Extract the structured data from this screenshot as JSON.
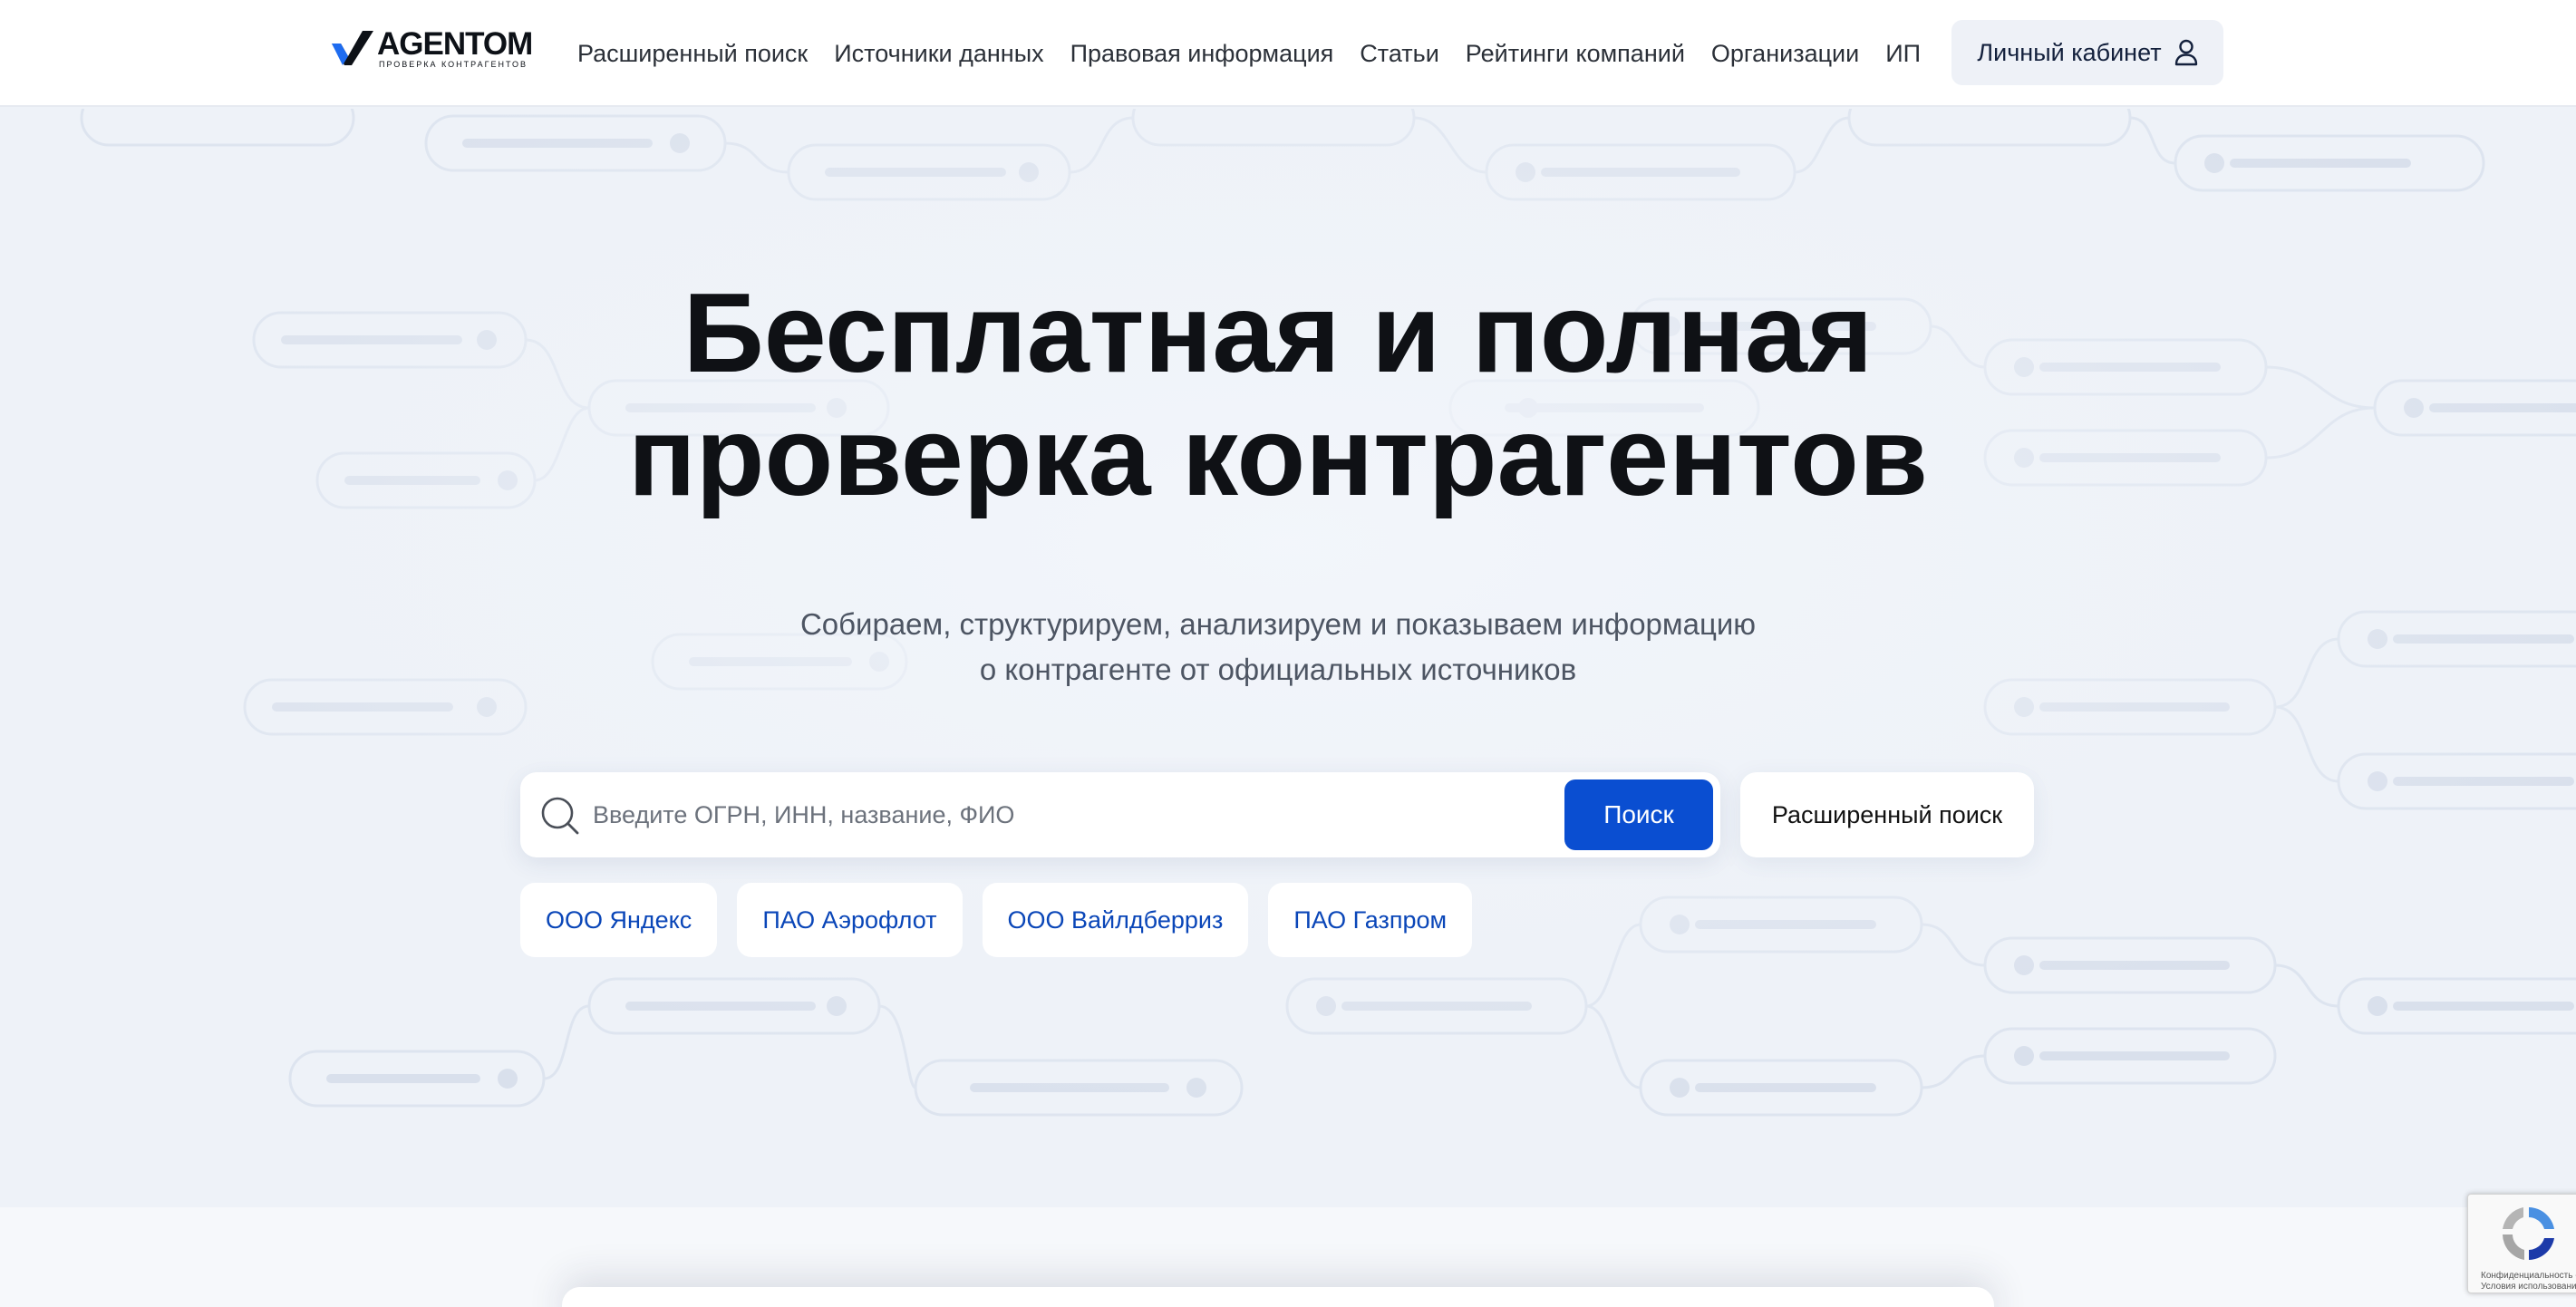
{
  "brand": {
    "name": "AGENTOM",
    "tagline": "ПРОВЕРКА КОНТРАГЕНТОВ"
  },
  "nav": {
    "items": [
      "Расширенный поиск",
      "Источники данных",
      "Правовая информация",
      "Статьи",
      "Рейтинги компаний",
      "Организации",
      "ИП"
    ]
  },
  "header": {
    "cabinet_label": "Личный кабинет",
    "cabinet_icon": "user-icon"
  },
  "hero": {
    "title_line1": "Бесплатная и полная",
    "title_line2": "проверка контрагентов",
    "subtitle_line1": "Собираем, структурируем, анализируем и показываем информацию",
    "subtitle_line2": "о контрагенте от официальных источников"
  },
  "search": {
    "placeholder": "Введите ОГРН, ИНН, название, ФИО",
    "value": "",
    "button_label": "Поиск",
    "advanced_label": "Расширенный поиск",
    "icon": "search-icon"
  },
  "suggestions": [
    "ООО Яндекс",
    "ПАО Аэрофлот",
    "ООО Вайлдберриз",
    "ПАО Газпром"
  ],
  "recaptcha": {
    "line1": "Конфиденциальность -",
    "line2": "Условия использования"
  },
  "colors": {
    "accent": "#0a4ed1",
    "chip_text": "#0a46b8",
    "background": "#eef2f8",
    "header_bg": "#ffffff"
  }
}
